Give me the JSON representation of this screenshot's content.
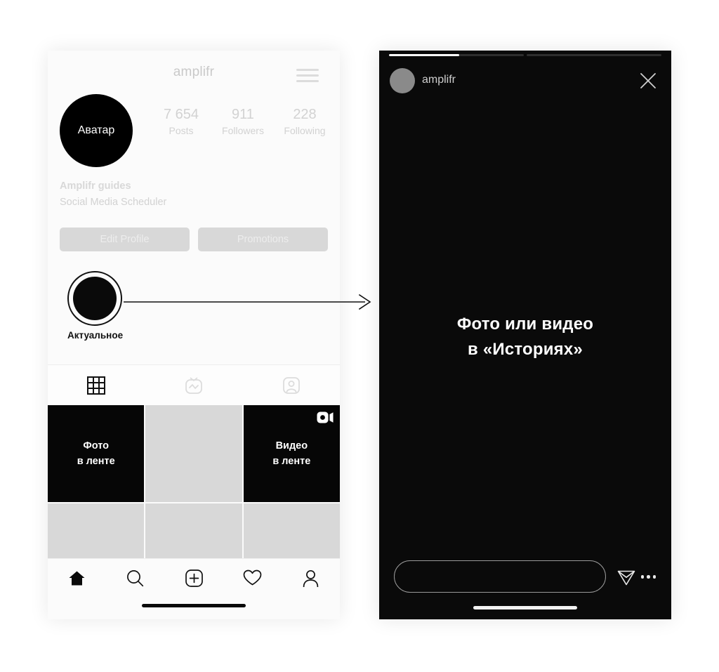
{
  "profile_phone": {
    "topbar": {
      "username": "amplifr",
      "menu_icon": "hamburger-menu-icon"
    },
    "avatar_label": "Аватар",
    "stats": [
      {
        "value": "7 654",
        "label": "Posts"
      },
      {
        "value": "911",
        "label": "Followers"
      },
      {
        "value": "228",
        "label": "Following"
      }
    ],
    "bio": {
      "name": "Amplifr guides",
      "description": "Social Media Scheduler"
    },
    "actions": [
      {
        "label": "Edit Profile"
      },
      {
        "label": "Promotions"
      }
    ],
    "highlights": [
      {
        "label": "Актуальное"
      }
    ],
    "tabs": [
      {
        "icon": "grid-icon",
        "active": true
      },
      {
        "icon": "igtv-icon",
        "active": false
      },
      {
        "icon": "tagged-person-icon",
        "active": false
      }
    ],
    "grid": [
      {
        "caption": "Фото\nв ленте",
        "caption_line1": "Фото",
        "caption_line2": "в ленте",
        "dark": true,
        "badge": ""
      },
      {
        "caption": "",
        "caption_line1": "",
        "caption_line2": "",
        "dark": false,
        "badge": ""
      },
      {
        "caption": "Видео\nв ленте",
        "caption_line1": "Видео",
        "caption_line2": "в ленте",
        "dark": true,
        "badge": "video-camera-icon"
      },
      {
        "caption": "",
        "caption_line1": "",
        "caption_line2": "",
        "dark": false,
        "badge": ""
      },
      {
        "caption": "",
        "caption_line1": "",
        "caption_line2": "",
        "dark": false,
        "badge": ""
      },
      {
        "caption": "",
        "caption_line1": "",
        "caption_line2": "",
        "dark": false,
        "badge": ""
      }
    ],
    "navbar": [
      {
        "icon": "home-icon",
        "active": true
      },
      {
        "icon": "search-icon",
        "active": false
      },
      {
        "icon": "add-post-icon",
        "active": false
      },
      {
        "icon": "heart-icon",
        "active": false
      },
      {
        "icon": "person-icon",
        "active": false
      }
    ]
  },
  "story_phone": {
    "progress": [
      {
        "fill_percent": 52
      },
      {
        "fill_percent": 0
      }
    ],
    "header": {
      "username": "amplifr",
      "close_icon": "close-x-icon"
    },
    "caption_line1": "Фото или видео",
    "caption_line2": "в «Историях»",
    "footer": {
      "reply_placeholder": "",
      "send_icon": "send-paper-plane-icon",
      "more_icon": "more-dots-icon"
    }
  },
  "connector": {
    "type": "arrow-right",
    "from": "highlight-circle",
    "to": "story-phone"
  },
  "colors": {
    "page_background": "#ffffff",
    "profile_background": "#fbfbfb",
    "story_background": "#0a0a0a",
    "muted_text": "#d2d2d2",
    "dark_tile": "#060606",
    "light_tile": "#d8d8d8"
  }
}
